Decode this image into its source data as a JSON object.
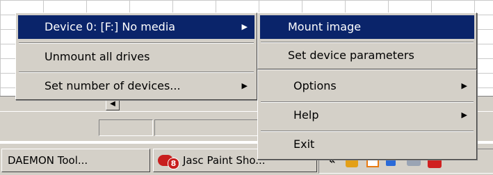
{
  "menu_main": {
    "items": [
      {
        "label": "Device 0: [F:] No media",
        "arrow": "▶"
      },
      {
        "label": "Unmount all drives"
      },
      {
        "label": "Set number of devices...",
        "arrow": "▶"
      }
    ]
  },
  "menu_device": {
    "items": [
      {
        "label": "Mount image"
      },
      {
        "label": "Set device parameters"
      }
    ]
  },
  "menu_tray": {
    "items": [
      {
        "label": "Options",
        "arrow": "▶"
      },
      {
        "label": "Help",
        "arrow": "▶"
      },
      {
        "label": "Exit"
      }
    ]
  },
  "taskbar": {
    "buttons": [
      {
        "label": "DAEMON Tool..."
      },
      {
        "label": "Jasc Paint Sho...",
        "badge": "8"
      }
    ],
    "tray_chevron": "«"
  },
  "scroll": {
    "left_arrow": "◀"
  },
  "colors": {
    "highlight": "#0a246a",
    "face": "#d4d0c8"
  }
}
